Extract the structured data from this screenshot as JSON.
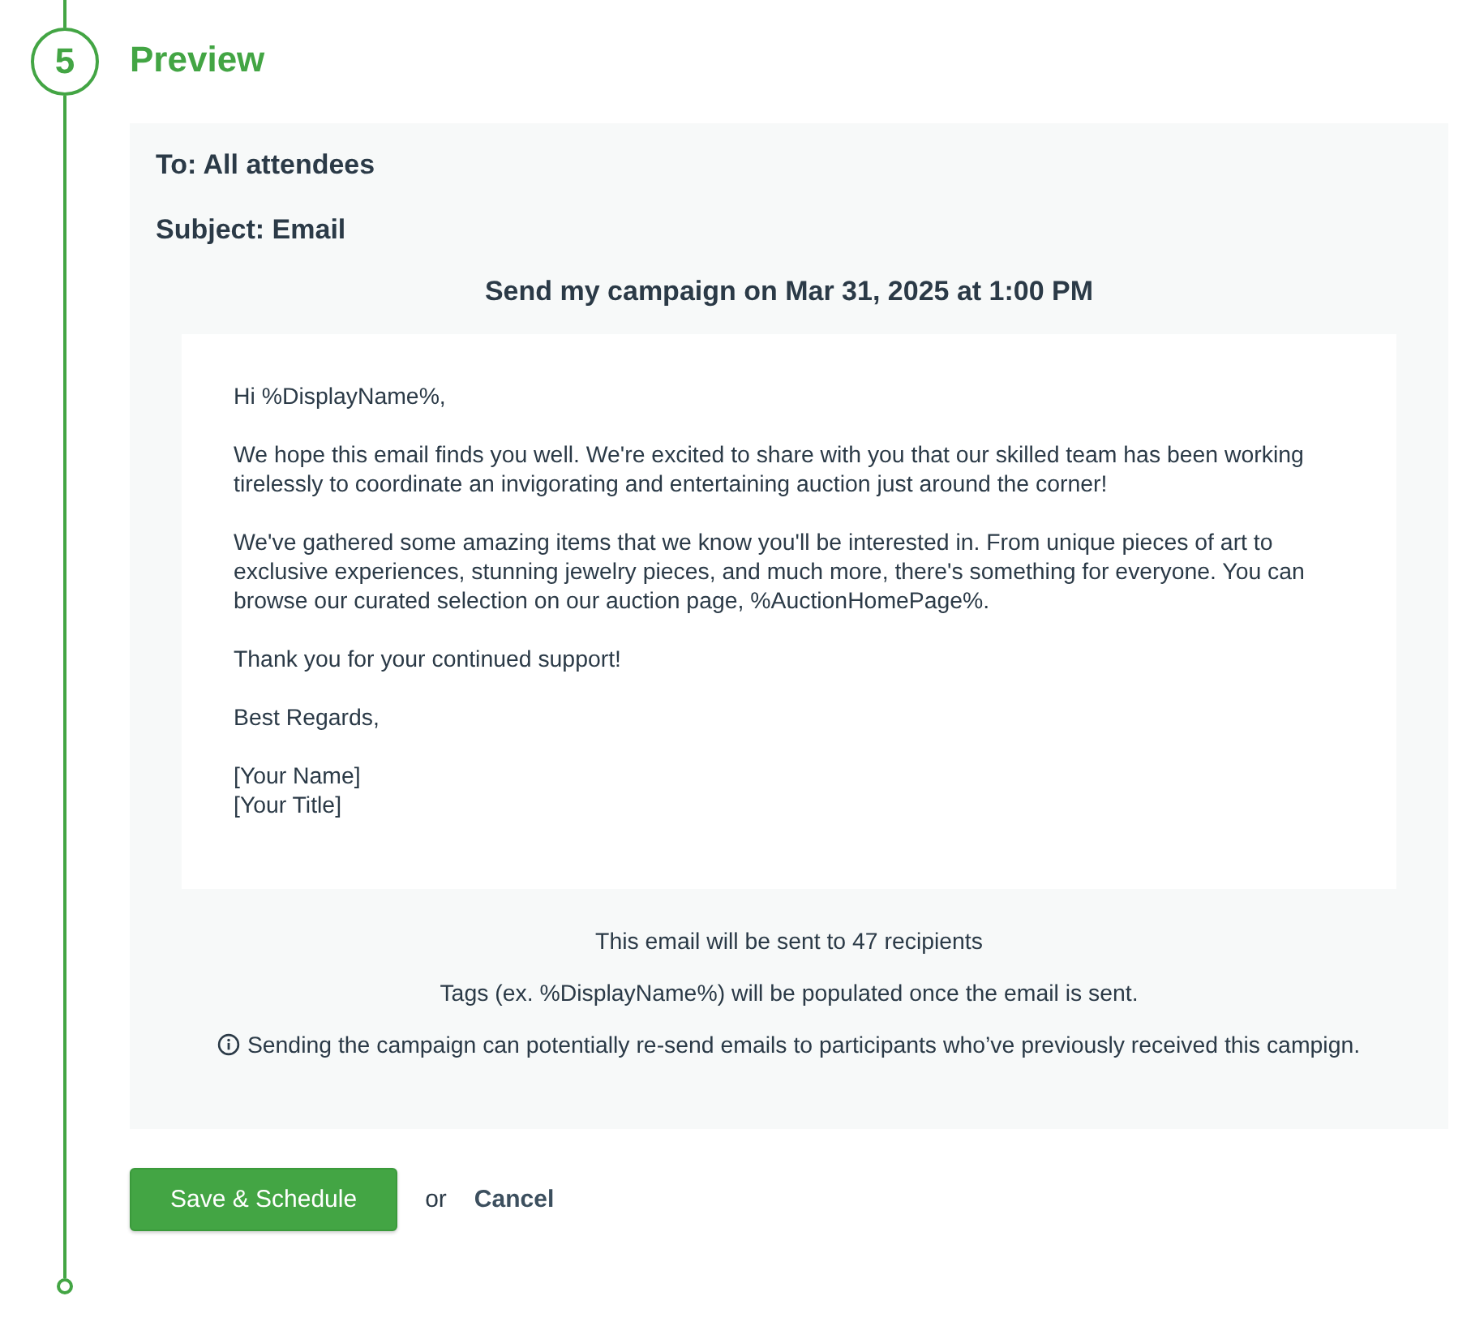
{
  "step": {
    "number": "5",
    "title": "Preview"
  },
  "preview": {
    "to": "To: All attendees",
    "subject": "Subject: Email",
    "schedule": "Send my campaign on Mar 31, 2025 at 1:00 PM",
    "email_body": [
      "Hi %DisplayName%,",
      "We hope this email finds you well. We're excited to share with you that our skilled team has been working tirelessly to coordinate an invigorating and entertaining auction just around the corner!",
      "We've gathered some amazing items that we know you'll be interested in. From unique pieces of art to exclusive experiences, stunning jewelry pieces, and much more, there's something for everyone. You can browse our curated selection on our auction page, %AuctionHomePage%.",
      "Thank you for your continued support!",
      "Best Regards,",
      "[Your Name]\n[Your Title]"
    ],
    "notes": [
      {
        "kind": "plain",
        "text": "This email will be sent to 47 recipients"
      },
      {
        "kind": "plain",
        "text": "Tags (ex. %DisplayName%) will be populated once the email is sent."
      },
      {
        "kind": "info",
        "text": "Sending the campaign can potentially re-send emails to participants who’ve previously received this campign."
      }
    ]
  },
  "actions": {
    "primary": "Save & Schedule",
    "separator": "or",
    "cancel": "Cancel"
  }
}
